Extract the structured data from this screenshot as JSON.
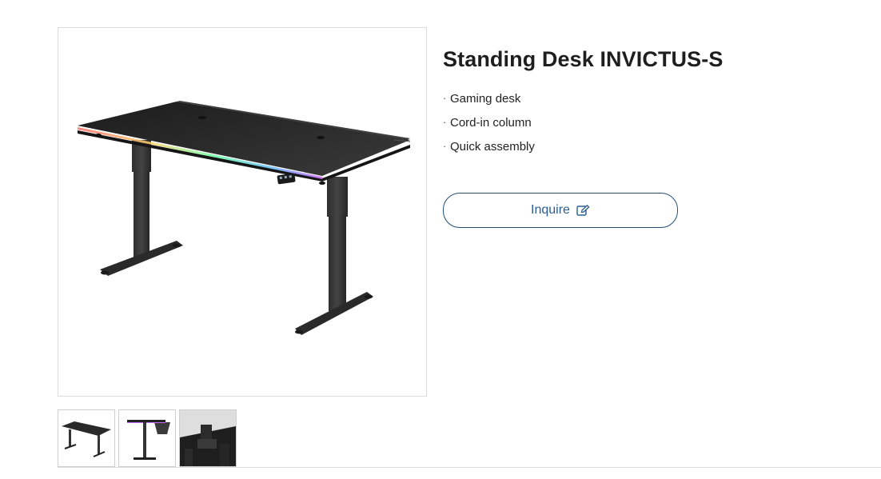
{
  "product": {
    "title": "Standing Desk INVICTUS-S",
    "features": [
      "Gaming desk",
      "Cord-in column",
      "Quick assembly"
    ],
    "inquire_label": "Inquire"
  },
  "gallery": {
    "main_image": "standing-desk-main-image",
    "thumbnails": [
      "desk-angle-thumbnail",
      "desk-side-thumbnail",
      "desk-detail-thumbnail"
    ]
  },
  "colors": {
    "accent": "#2a5d8f",
    "button_border": "#1f4e79",
    "desk": "#2b2b2b"
  }
}
